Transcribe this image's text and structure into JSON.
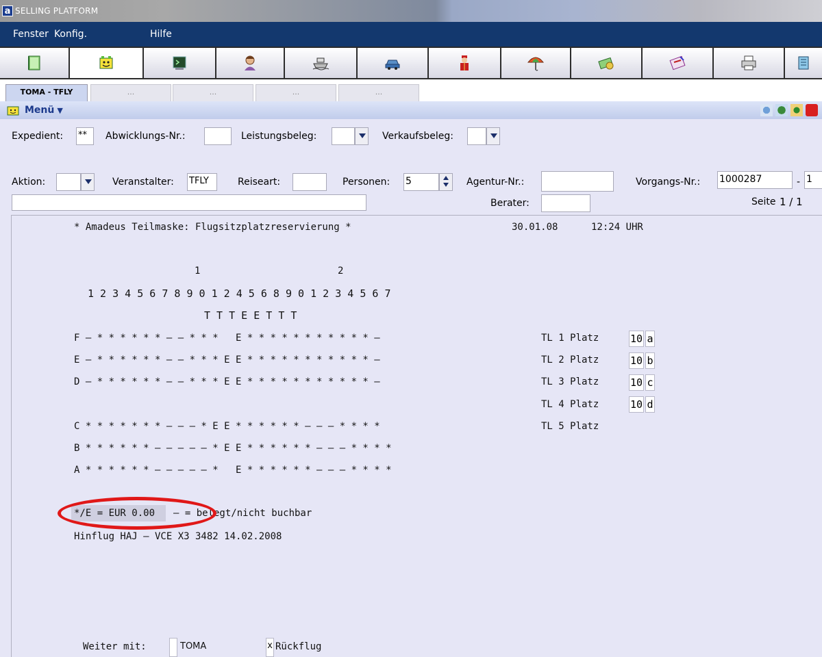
{
  "window": {
    "title": "SELLING PLATFORM",
    "app_icon": "a"
  },
  "menubar": {
    "items": [
      "Fenster",
      "Konfig.",
      "Hilfe"
    ]
  },
  "toolbar": {
    "icons": [
      "book-icon",
      "smiley-icon",
      "terminal-icon",
      "agent-icon",
      "ship-icon",
      "car-icon",
      "bellboy-icon",
      "umbrella-icon",
      "money-icon",
      "ticket-icon",
      "printer-icon",
      "folder-icon"
    ],
    "active_index": 1
  },
  "tabs": {
    "active": "TOMA - TFLY",
    "inactive": [
      "...",
      "...",
      "...",
      "..."
    ]
  },
  "menustrip": {
    "label": "Menü"
  },
  "form": {
    "expedient_label": "Expedient:",
    "expedient_value": "**",
    "abwicklung_label": "Abwicklungs-Nr.:",
    "leistungsbeleg_label": "Leistungsbeleg:",
    "verkaufsbeleg_label": "Verkaufsbeleg:",
    "aktion_label": "Aktion:",
    "veranstalter_label": "Veranstalter:",
    "veranstalter_value": "TFLY",
    "reiseart_label": "Reiseart:",
    "personen_label": "Personen:",
    "personen_value": "5",
    "agentur_label": "Agentur-Nr.:",
    "vorgang_label": "Vorgangs-Nr.:",
    "vorgang_value": "1000287",
    "vorgang_sep": "-",
    "vorgang_suffix": "1",
    "berater_label": "Berater:",
    "seite_label": "Seite",
    "seite_value": "1 / 1"
  },
  "terminal": {
    "header": "* Amadeus Teilmaske: Flugsitzplatzreservierung *",
    "date": "30.01.08",
    "time": "12:24 UHR",
    "tens_1": "1",
    "tens_2": "2",
    "row_numbers": "1 2 3 4 5 6 7 8 9 0 1 2 4 5 6 8 9 0 1 2 3 4 5 6 7",
    "type_row": "T T T E E T T T",
    "rows": [
      "F – * * * * * * – – * * *   E * * * * * * * * * * * –",
      "E – * * * * * * – – * * * E E * * * * * * * * * * * –",
      "D – * * * * * * – – * * * E E * * * * * * * * * * * –",
      "C * * * * * * * – – – * E E * * * * * * – – – * * * *",
      "B * * * * * * – – – – – * E E * * * * * * – – – * * * *",
      "A * * * * * * – – – – – *   E * * * * * * – – – * * * *"
    ],
    "tl": [
      {
        "label": "TL 1 Platz",
        "num": "10",
        "letter": "a"
      },
      {
        "label": "TL 2 Platz",
        "num": "10",
        "letter": "b"
      },
      {
        "label": "TL 3 Platz",
        "num": "10",
        "letter": "c"
      },
      {
        "label": "TL 4 Platz",
        "num": "10",
        "letter": "d"
      },
      {
        "label": "TL 5 Platz"
      }
    ],
    "legend_price": "*/E = EUR 0.00",
    "legend_rest": "– = belegt/nicht buchbar",
    "flight_info": "Hinflug HAJ – VCE X3 3482 14.02.2008",
    "weiter_label": "Weiter mit:",
    "weiter_value": "TOMA",
    "rueckflug_mark": "x",
    "rueckflug_label": "Rückflug"
  },
  "colors": {
    "menubar": "#13386e",
    "background": "#e6e6f6",
    "highlight": "#e01818"
  }
}
